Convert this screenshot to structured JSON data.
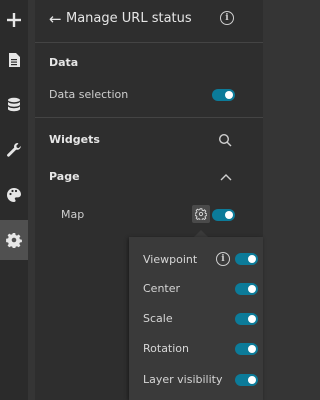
{
  "header": {
    "title": "Manage URL status"
  },
  "data_section": {
    "title": "Data",
    "item_label": "Data selection",
    "item_on": true
  },
  "widgets_section": {
    "title": "Widgets"
  },
  "page_section": {
    "title": "Page",
    "item_label": "Map",
    "item_on": true
  },
  "popover": {
    "items": [
      {
        "label": "Viewpoint",
        "on": true,
        "has_info": true
      },
      {
        "label": "Center",
        "on": true
      },
      {
        "label": "Scale",
        "on": true
      },
      {
        "label": "Rotation",
        "on": true
      },
      {
        "label": "Layer visibility",
        "on": true
      }
    ]
  },
  "colors": {
    "accent": "#0c7b99",
    "panel_bg": "#2e2e2e",
    "rail_bg": "#2b2b2b"
  },
  "rail_icons": [
    "plus-icon",
    "page-icon",
    "database-icon",
    "wrench-icon",
    "palette-icon",
    "gear-icon"
  ]
}
